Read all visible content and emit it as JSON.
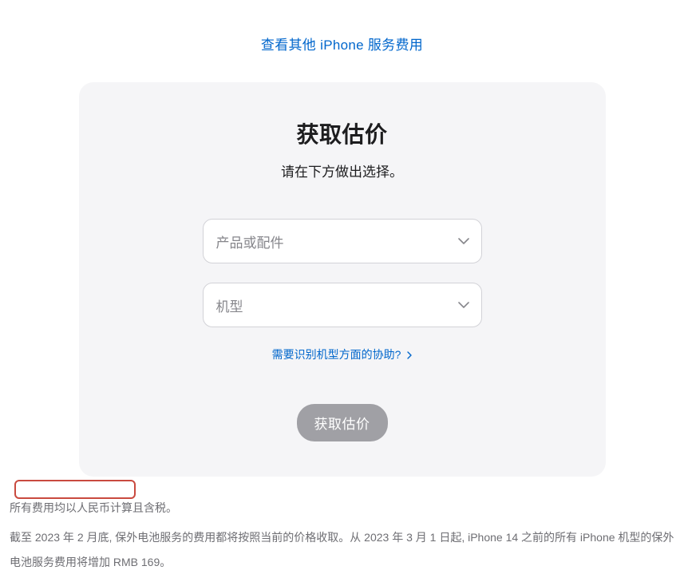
{
  "topLink": {
    "label": "查看其他 iPhone 服务费用"
  },
  "card": {
    "title": "获取估价",
    "subtitle": "请在下方做出选择。",
    "select1": {
      "placeholder": "产品或配件"
    },
    "select2": {
      "placeholder": "机型"
    },
    "helpLink": {
      "label": "需要识别机型方面的协助?"
    },
    "submit": {
      "label": "获取估价"
    }
  },
  "footer": {
    "note1": "所有费用均以人民币计算且含税。",
    "note2": "截至 2023 年 2 月底, 保外电池服务的费用都将按照当前的价格收取。从 2023 年 3 月 1 日起, iPhone 14 之前的所有 iPhone 机型的保外电池服务费用将增加 RMB 169。"
  }
}
